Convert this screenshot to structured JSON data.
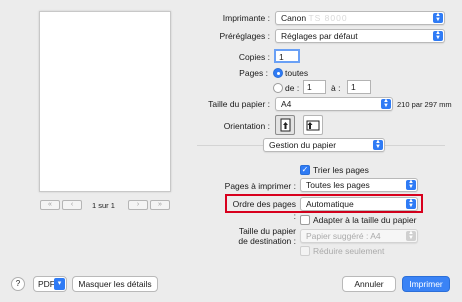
{
  "preview": {
    "page_counter": "1 sur 1",
    "first": "«",
    "prev": "‹",
    "next": "›",
    "last": "»"
  },
  "printer": {
    "label": "Imprimante :",
    "value": "Canon",
    "value_hidden": "TS 8000"
  },
  "presets": {
    "label": "Préréglages :",
    "value": "Réglages par défaut"
  },
  "copies": {
    "label": "Copies :",
    "value": "1"
  },
  "pages": {
    "label": "Pages :",
    "all_label": "toutes",
    "from_label": "de :",
    "from_value": "1",
    "to_label": "à :",
    "to_value": "1"
  },
  "paper_size": {
    "label": "Taille du papier :",
    "value": "A4",
    "dimensions": "210 par 297 mm"
  },
  "orientation": {
    "label": "Orientation :"
  },
  "section": {
    "value": "Gestion du papier"
  },
  "collate": {
    "label": "Trier les pages",
    "checked": true
  },
  "pages_to_print": {
    "label": "Pages à imprimer :",
    "value": "Toutes les pages"
  },
  "page_order": {
    "label": "Ordre des pages :",
    "value": "Automatique"
  },
  "scale_to_fit": {
    "label": "Adapter à la taille du papier",
    "checked": false
  },
  "dest_paper": {
    "label_line1": "Taille du papier",
    "label_line2": "de destination :",
    "value": "Papier suggéré : A4"
  },
  "scale_down_only": {
    "label": "Réduire seulement"
  },
  "footer": {
    "help": "?",
    "pdf": "PDF",
    "details": "Masquer les détails",
    "cancel": "Annuler",
    "print": "Imprimer"
  },
  "colors": {
    "accent": "#2f7bf5",
    "highlight": "#d8001d"
  }
}
